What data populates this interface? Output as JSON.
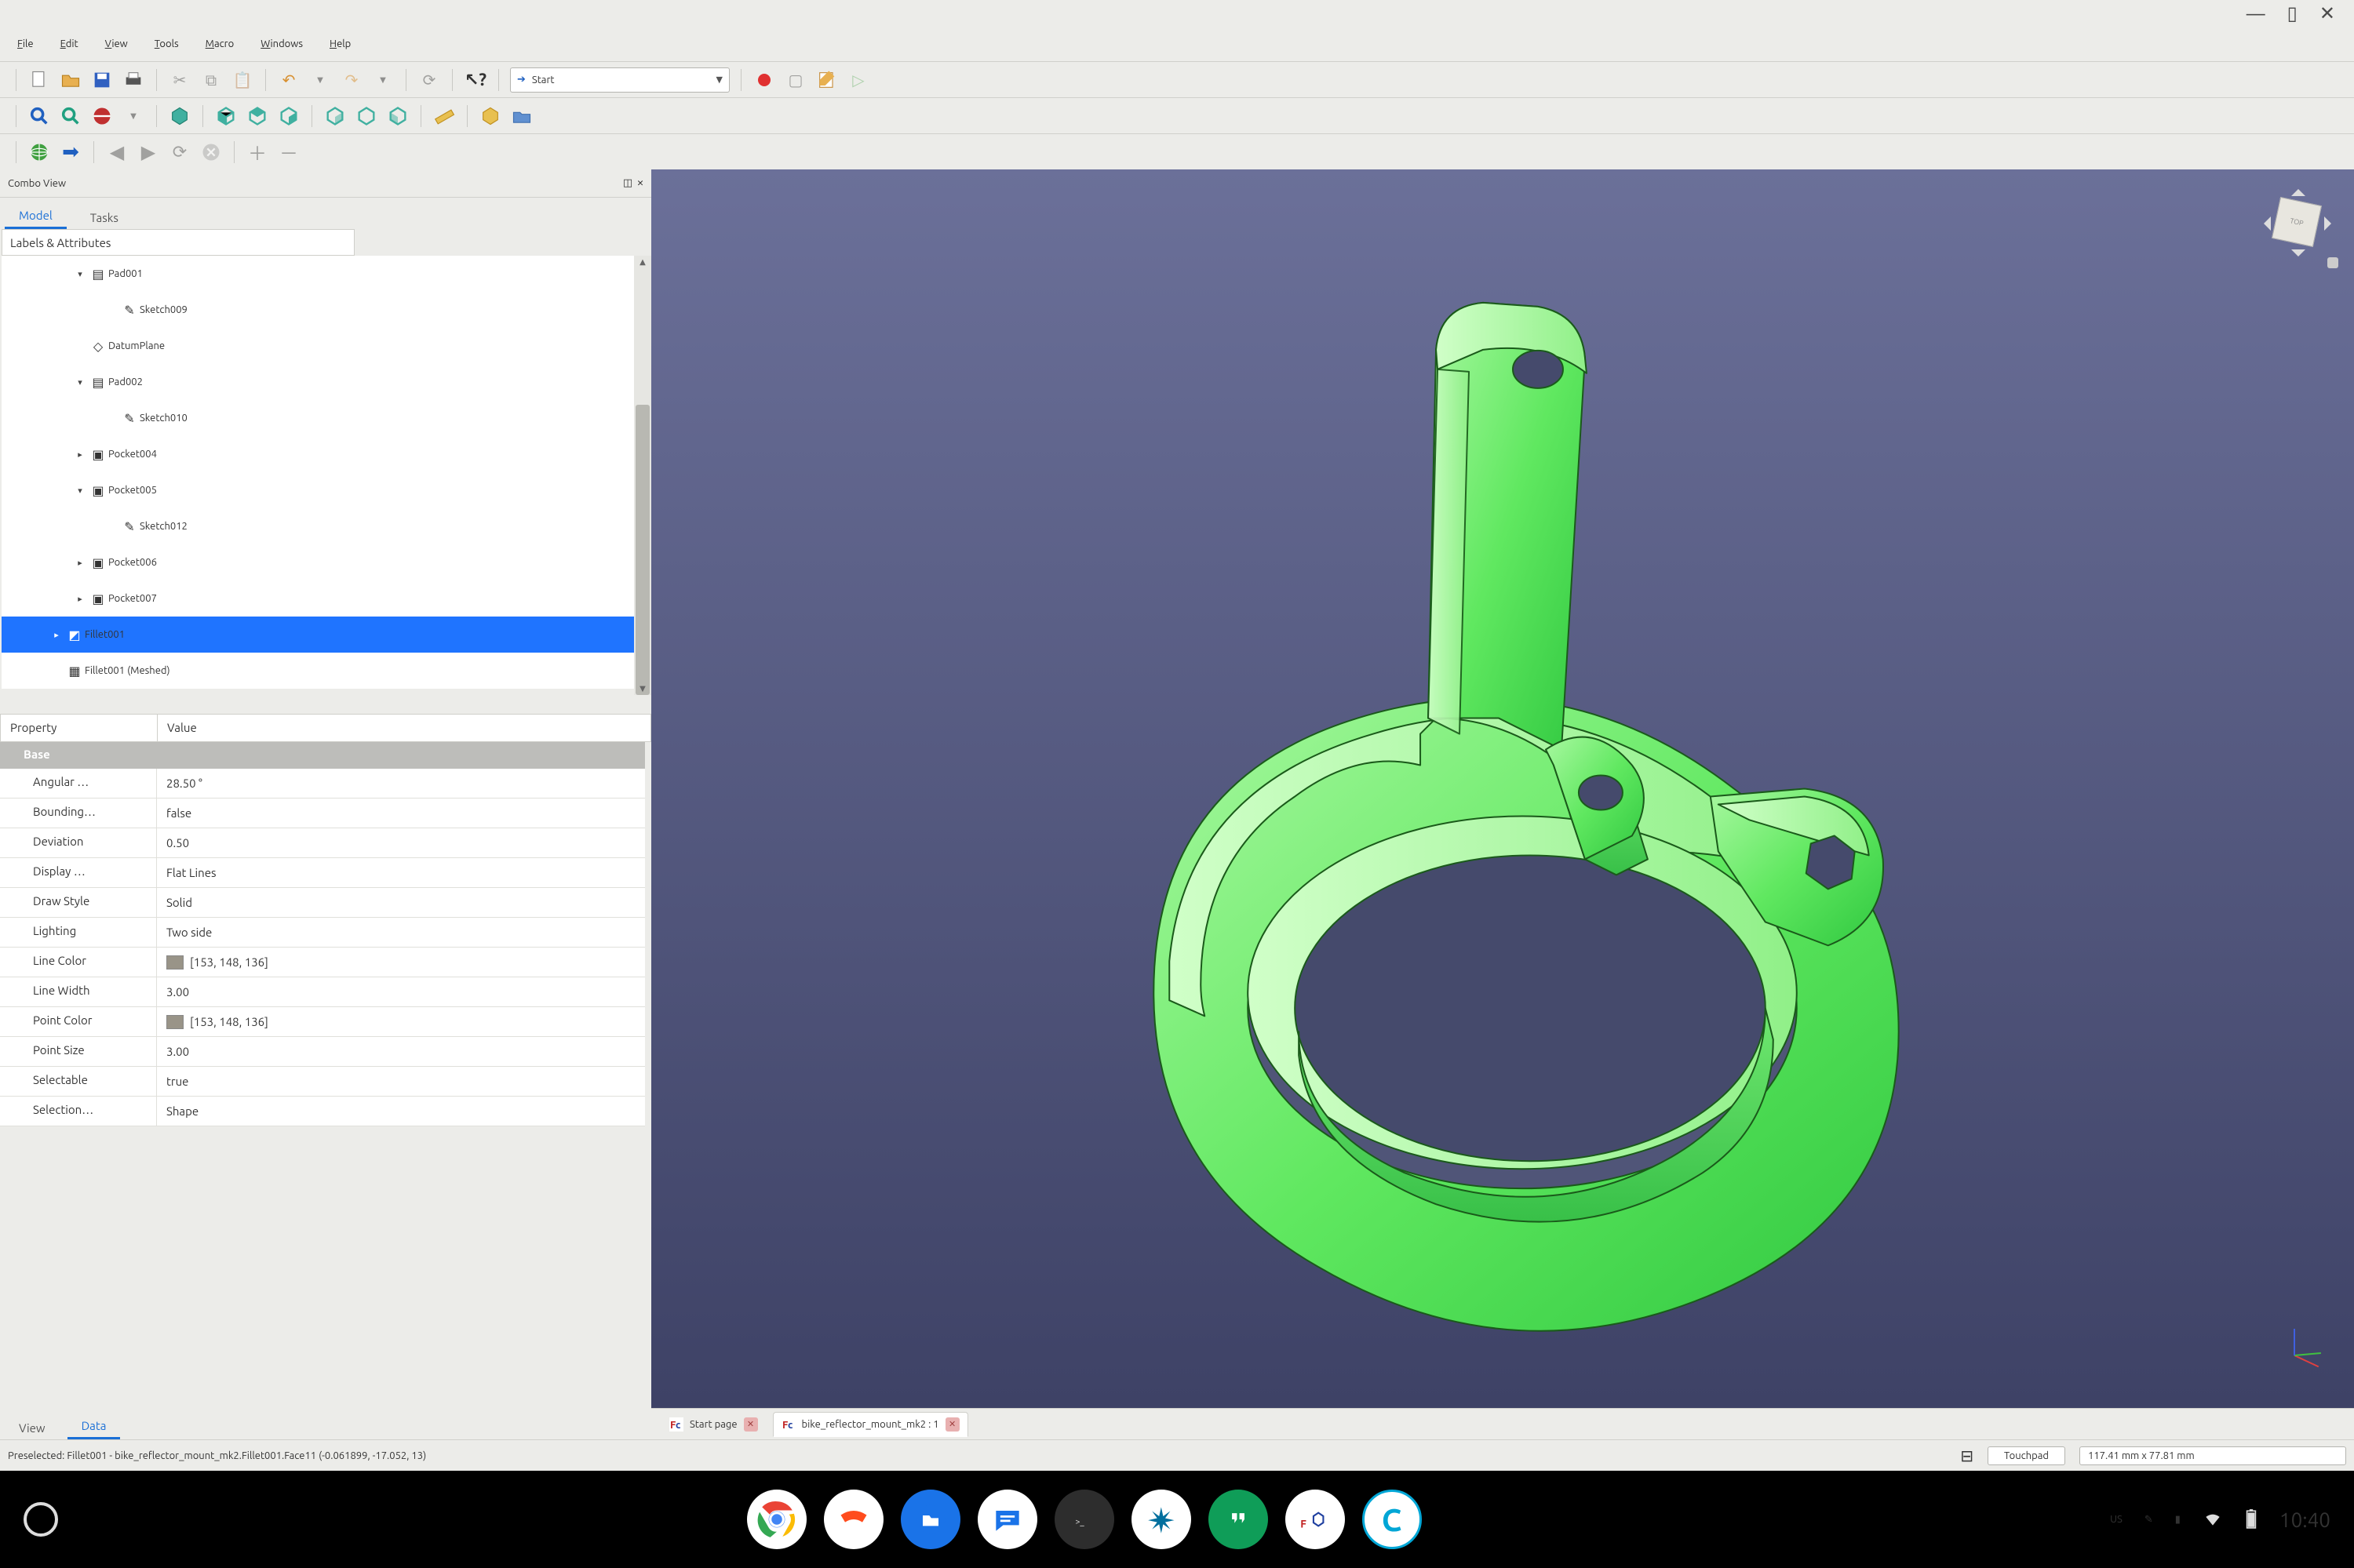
{
  "window_controls": {
    "min": "—",
    "max": "▯",
    "close": "✕"
  },
  "menu": [
    "File",
    "Edit",
    "View",
    "Tools",
    "Macro",
    "Windows",
    "Help"
  ],
  "toolbar_row1": {
    "workbench_arrow": "➔",
    "workbench_label": "Start",
    "rec": "●"
  },
  "combo": {
    "title": "Combo View",
    "tabs": {
      "model": "Model",
      "tasks": "Tasks"
    }
  },
  "tree_header": "Labels & Attributes",
  "tree": [
    {
      "pad": "pad1",
      "tw": "▾",
      "ic": "▤",
      "label": "Pad001"
    },
    {
      "pad": "pad2",
      "tw": "",
      "ic": "✎",
      "label": "Sketch009"
    },
    {
      "pad": "pad1",
      "tw": "",
      "ic": "◇",
      "label": "DatumPlane"
    },
    {
      "pad": "pad1",
      "tw": "▾",
      "ic": "▤",
      "label": "Pad002"
    },
    {
      "pad": "pad2",
      "tw": "",
      "ic": "✎",
      "label": "Sketch010"
    },
    {
      "pad": "pad1",
      "tw": "▸",
      "ic": "▣",
      "label": "Pocket004"
    },
    {
      "pad": "pad1",
      "tw": "▾",
      "ic": "▣",
      "label": "Pocket005"
    },
    {
      "pad": "pad2",
      "tw": "",
      "ic": "✎",
      "label": "Sketch012"
    },
    {
      "pad": "pad1",
      "tw": "▸",
      "ic": "▣",
      "label": "Pocket006"
    },
    {
      "pad": "pad1",
      "tw": "▸",
      "ic": "▣",
      "label": "Pocket007"
    },
    {
      "pad": "pad3",
      "tw": "▸",
      "ic": "◩",
      "label": "Fillet001",
      "sel": true
    },
    {
      "pad": "pad3",
      "tw": "",
      "ic": "▦",
      "label": "Fillet001 (Meshed)",
      "dim": true
    }
  ],
  "prop": {
    "hprop": "Property",
    "hval": "Value",
    "section": "Base",
    "rows": [
      {
        "k": "Angular …",
        "v": "28.50 °"
      },
      {
        "k": "Bounding…",
        "v": "false"
      },
      {
        "k": "Deviation",
        "v": "0.50"
      },
      {
        "k": "Display …",
        "v": "Flat Lines"
      },
      {
        "k": "Draw Style",
        "v": "Solid"
      },
      {
        "k": "Lighting",
        "v": "Two side"
      },
      {
        "k": "Line Color",
        "v": "[153, 148, 136]",
        "swatch": true
      },
      {
        "k": "Line Width",
        "v": "3.00"
      },
      {
        "k": "Point Color",
        "v": "[153, 148, 136]",
        "swatch": true
      },
      {
        "k": "Point Size",
        "v": "3.00"
      },
      {
        "k": "Selectable",
        "v": "true"
      },
      {
        "k": "Selection…",
        "v": "Shape"
      }
    ]
  },
  "bottom_tabs": {
    "view": "View",
    "data": "Data"
  },
  "doc_tabs": {
    "start": "Start page",
    "doc": "bike_reflector_mount_mk2 : 1"
  },
  "status": {
    "left": "Preselected: Fillet001 - bike_reflector_mount_mk2.Fillet001.Face11 (-0.061899, -17.052, 13)",
    "touchpad": "Touchpad",
    "dims": "117.41 mm x 77.81 mm"
  },
  "taskbar": {
    "lang": "US",
    "time": "10:40"
  },
  "nav_cube": "TOP"
}
